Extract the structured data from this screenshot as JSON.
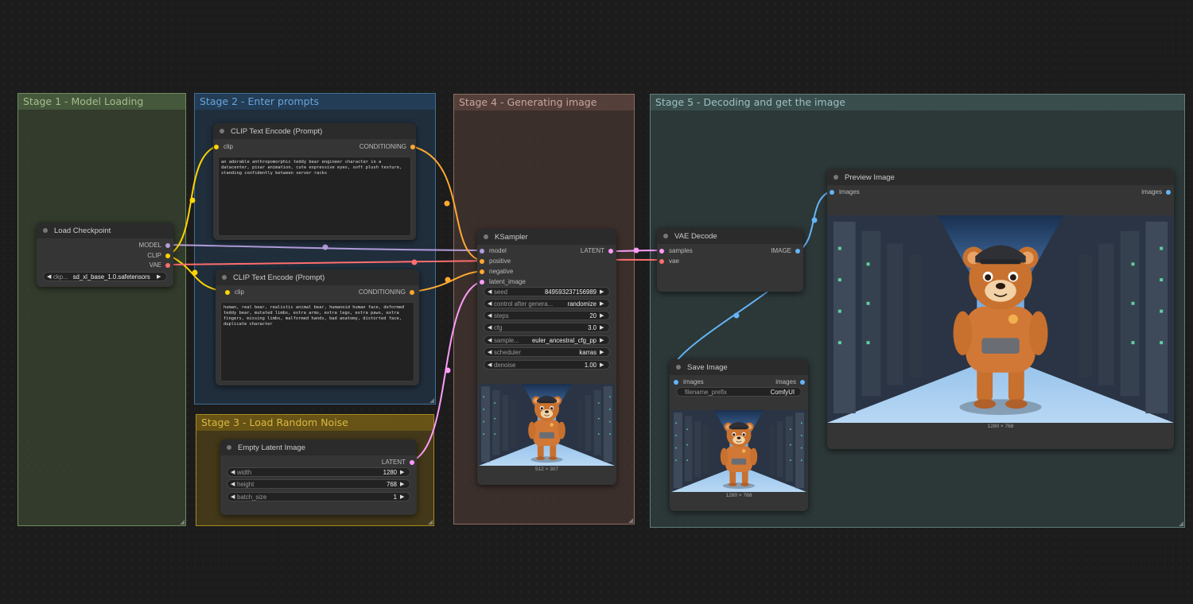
{
  "groups": {
    "stage1": "Stage 1 - Model Loading",
    "stage2": "Stage 2 - Enter prompts",
    "stage3": "Stage 3 - Load Random Noise",
    "stage4": "Stage 4 - Generating image",
    "stage5": "Stage 5 - Decoding and get the image"
  },
  "load_checkpoint": {
    "title": "Load Checkpoint",
    "outputs": [
      "MODEL",
      "CLIP",
      "VAE"
    ],
    "ckpt_label": "ckp...",
    "ckpt_value": "sd_xl_base_1.0.safetensors"
  },
  "clip_pos": {
    "title": "CLIP Text Encode (Prompt)",
    "input": "clip",
    "output": "CONDITIONING",
    "text": "an adorable anthropomorphic teddy bear engineer character in a datacenter, pixar animation, cute expressive eyes, soft plush texture, standing confidently between server racks"
  },
  "clip_neg": {
    "title": "CLIP Text Encode (Prompt)",
    "input": "clip",
    "output": "CONDITIONING",
    "text": "human, real bear, realistic animal bear, humanoid human face, deformed teddy bear, mutated limbs, extra arms, extra legs, extra paws, extra fingers, missing limbs, malformed hands, bad anatomy, distorted face, duplicate character"
  },
  "empty_latent": {
    "title": "Empty Latent Image",
    "output": "LATENT",
    "widgets": [
      {
        "label": "width",
        "value": "1280"
      },
      {
        "label": "height",
        "value": "768"
      },
      {
        "label": "batch_size",
        "value": "1"
      }
    ]
  },
  "ksampler": {
    "title": "KSampler",
    "inputs": [
      "model",
      "positive",
      "negative",
      "latent_image"
    ],
    "output": "LATENT",
    "widgets": [
      {
        "label": "seed",
        "value": "849593237156989"
      },
      {
        "label": "control after genera...",
        "value": "randomize"
      },
      {
        "label": "steps",
        "value": "20"
      },
      {
        "label": "cfg",
        "value": "3.0"
      },
      {
        "label": "sample...",
        "value": "euler_ancestral_cfg_pp"
      },
      {
        "label": "scheduler",
        "value": "karras"
      },
      {
        "label": "denoise",
        "value": "1.00"
      }
    ],
    "preview_size": "512 × 307"
  },
  "vae_decode": {
    "title": "VAE Decode",
    "inputs": [
      "samples",
      "vae"
    ],
    "output": "IMAGE"
  },
  "preview_image": {
    "title": "Preview Image",
    "input": "images",
    "output": "images",
    "size": "1280 × 768"
  },
  "save_image": {
    "title": "Save Image",
    "input": "images",
    "output": "images",
    "prefix_label": "filename_prefix",
    "prefix_value": "ComfyUI",
    "size": "1280 × 768"
  },
  "colors": {
    "model": "#b39ddb",
    "clip": "#ffd500",
    "vae": "#ff6e6e",
    "conditioning": "#ffa931",
    "latent": "#ff9cf9",
    "image": "#64b5f6"
  }
}
